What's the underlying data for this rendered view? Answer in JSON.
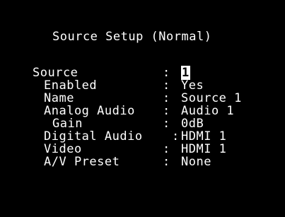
{
  "menu": {
    "title": "Source Setup (Normal)"
  },
  "rows": [
    {
      "label": "Source",
      "value": "1"
    },
    {
      "label": "Enabled",
      "value": "Yes"
    },
    {
      "label": "Name",
      "value": "Source 1"
    },
    {
      "label": "Analog Audio",
      "value": "Audio 1"
    },
    {
      "label": "Gain",
      "value": "0dB"
    },
    {
      "label": "Digital Audio",
      "value": "HDMI 1"
    },
    {
      "label": "Video",
      "value": "HDMI 1"
    },
    {
      "label": "A/V Preset",
      "value": "None"
    }
  ],
  "separator": ":"
}
